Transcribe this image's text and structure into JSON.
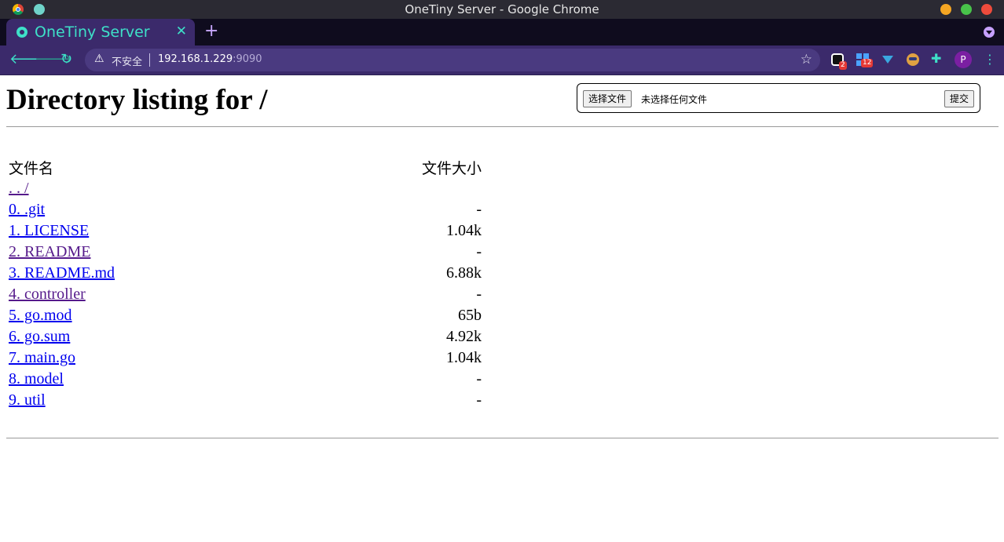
{
  "window": {
    "title": "OneTiny Server - Google Chrome"
  },
  "tab": {
    "title": "OneTiny Server",
    "close": "✕",
    "new_tab": "+"
  },
  "address_bar": {
    "security_label": "不安全",
    "host": "192.168.1.229",
    "port": ":9090"
  },
  "extensions": {
    "ext1_badge": "2",
    "ext2_badge": "12",
    "profile_initial": "P"
  },
  "page": {
    "heading": "Directory listing for /",
    "upload": {
      "choose_label": "选择文件",
      "no_file_text": "未选择任何文件",
      "submit_label": "提交"
    },
    "columns": {
      "name": "文件名",
      "size": "文件大小"
    },
    "parent_link": ". . /",
    "rows": [
      {
        "name": "0. .git",
        "size": "-",
        "visited": false
      },
      {
        "name": "1. LICENSE",
        "size": "1.04k",
        "visited": false
      },
      {
        "name": "2. README",
        "size": "-",
        "visited": true
      },
      {
        "name": "3. README.md",
        "size": "6.88k",
        "visited": false
      },
      {
        "name": "4. controller",
        "size": "-",
        "visited": true
      },
      {
        "name": "5. go.mod",
        "size": "65b",
        "visited": false
      },
      {
        "name": "6. go.sum",
        "size": "4.92k",
        "visited": false
      },
      {
        "name": "7. main.go",
        "size": "1.04k",
        "visited": false
      },
      {
        "name": "8. model",
        "size": "-",
        "visited": false
      },
      {
        "name": "9. util",
        "size": "-",
        "visited": false
      }
    ]
  }
}
